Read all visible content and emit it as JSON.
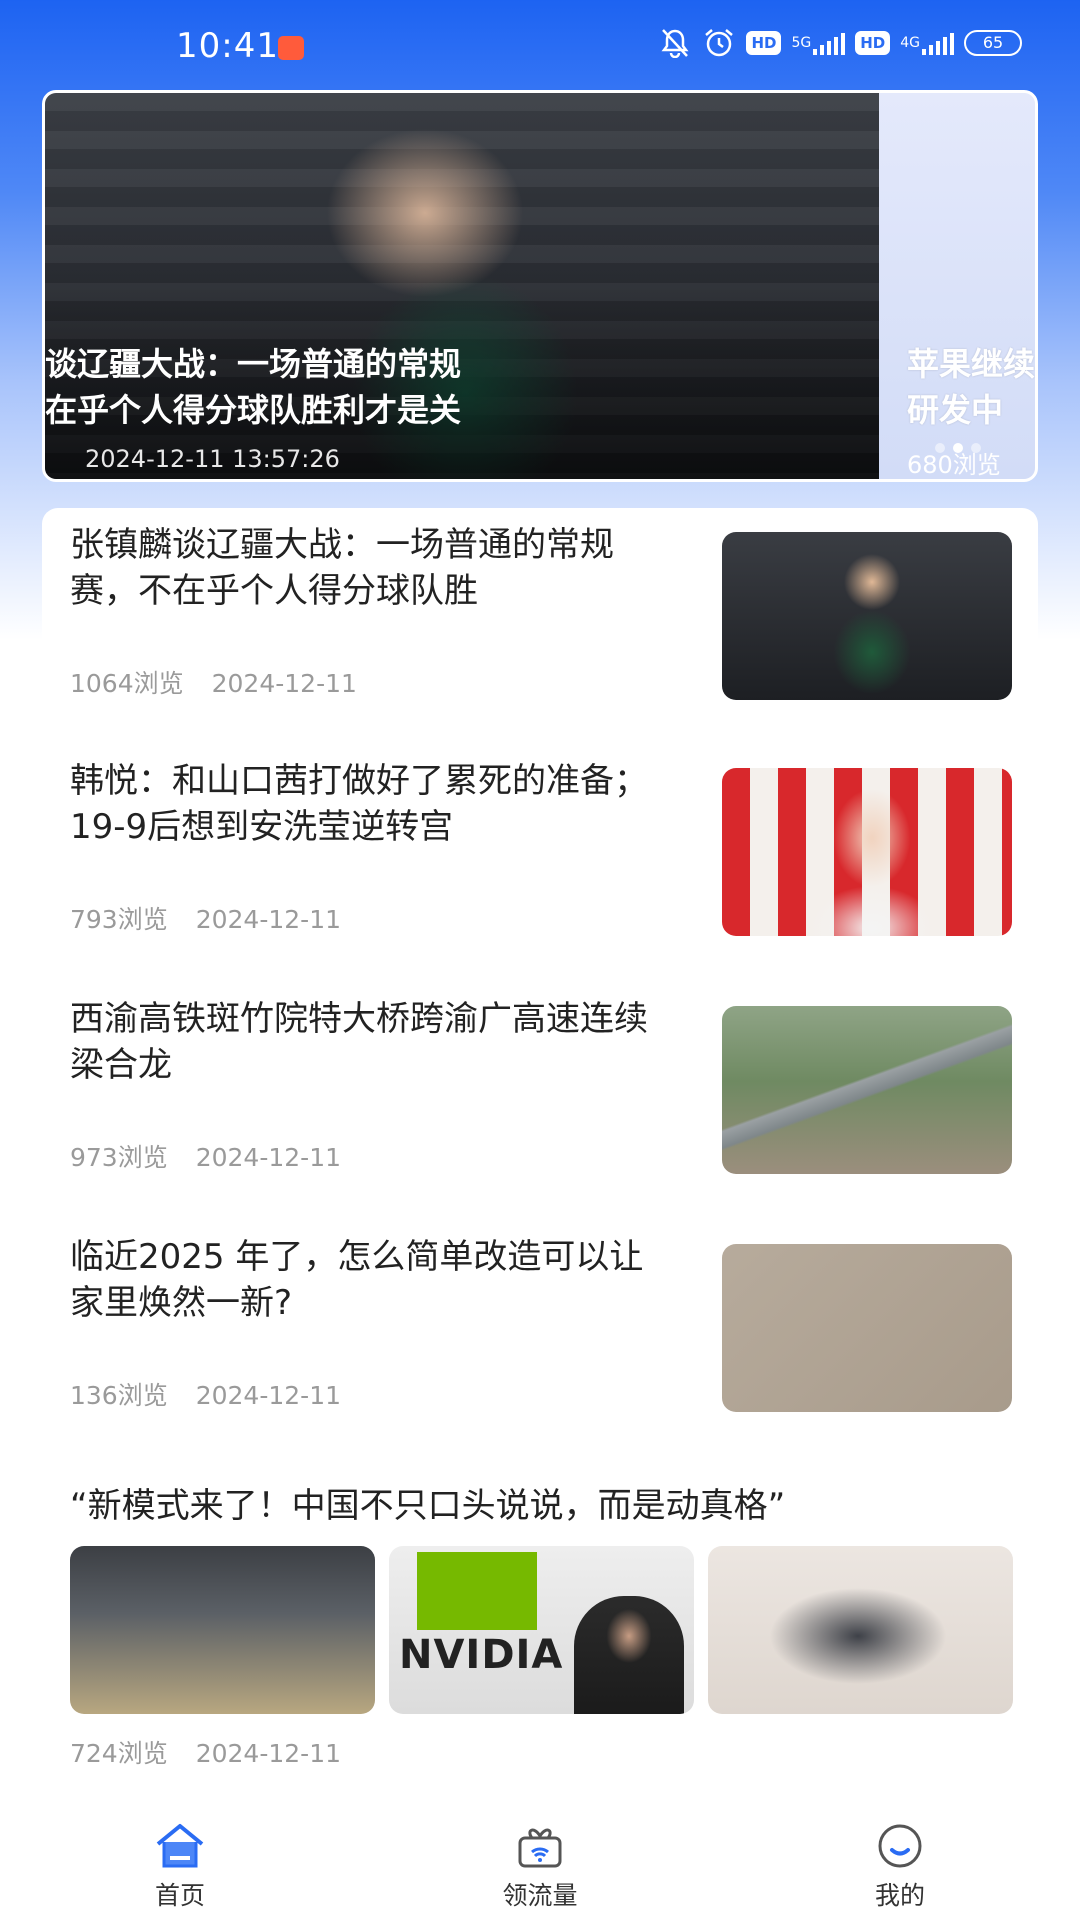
{
  "status_bar": {
    "time": "10:41",
    "battery": "65",
    "net1": "5G",
    "net2": "4G",
    "hd": "HD"
  },
  "carousel": {
    "main": {
      "title_line1": "谈辽疆大战：一场普通的常规",
      "title_line2": "在乎个人得分球队胜利才是关",
      "date": "2024-12-11 13:57:26"
    },
    "next": {
      "title_line1": "苹果继续",
      "title_line2": "研发中",
      "views": "680浏览"
    }
  },
  "news": [
    {
      "title": "张镇麟谈辽疆大战：一场普通的常规赛，不在乎个人得分球队胜",
      "views": "1064浏览",
      "date": "2024-12-11"
    },
    {
      "title": "韩悦：和山口茜打做好了累死的准备；19-9后想到安洗莹逆转宫",
      "views": "793浏览",
      "date": "2024-12-11"
    },
    {
      "title": "西渝高铁斑竹院特大桥跨渝广高速连续梁合龙",
      "views": "973浏览",
      "date": "2024-12-11"
    },
    {
      "title": "临近2025 年了，怎么简单改造可以让家里焕然一新?",
      "views": "136浏览",
      "date": "2024-12-11"
    }
  ],
  "multi": {
    "title": "“新模式来了！中国不只口头说说，而是动真格”",
    "nvidia_text": "NVIDIA",
    "views": "724浏览",
    "date": "2024-12-11"
  },
  "nav": {
    "home": "首页",
    "traffic": "领流量",
    "mine": "我的"
  },
  "colors": {
    "accent": "#2a6cf3",
    "gradient_top": "#1d63f2"
  }
}
